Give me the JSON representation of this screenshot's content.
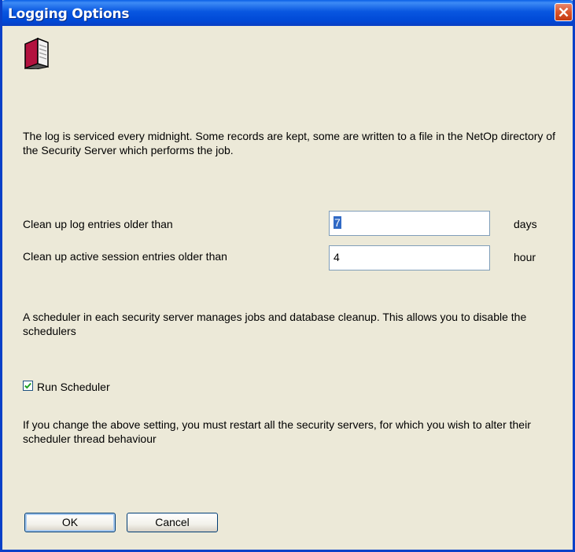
{
  "window": {
    "title": "Logging Options"
  },
  "icon": {
    "name": "book-icon"
  },
  "intro_text": "The log is serviced every midnight. Some records are kept, some are written to a file in the NetOp directory of the Security Server which performs the job.",
  "cleanup": {
    "log_label": "Clean up log entries older than",
    "log_value": "7",
    "log_unit": "days",
    "session_label": "Clean up active session entries older than",
    "session_value": "4",
    "session_unit": "hour"
  },
  "scheduler_text": "A scheduler in each security server manages jobs and database cleanup. This allows you to disable the schedulers",
  "run_scheduler": {
    "label": "Run Scheduler",
    "checked": true
  },
  "restart_text": "If you change the above setting, you must restart all the security servers, for which you wish  to alter their scheduler thread behaviour",
  "buttons": {
    "ok": "OK",
    "cancel": "Cancel"
  },
  "colors": {
    "titlebar": "#0856e0",
    "dialog_bg": "#ece9d8",
    "close": "#d9542b",
    "selection": "#316ac5"
  }
}
